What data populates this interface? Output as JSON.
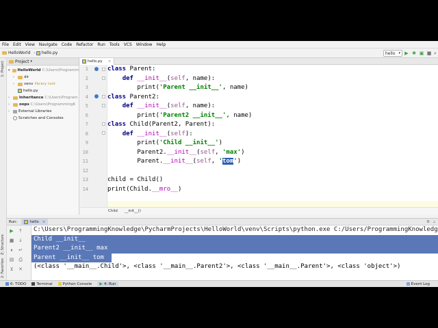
{
  "menu": [
    "File",
    "Edit",
    "View",
    "Navigate",
    "Code",
    "Refactor",
    "Run",
    "Tools",
    "VCS",
    "Window",
    "Help"
  ],
  "nav": {
    "project": "HelloWorld",
    "file": "hello.py"
  },
  "toolbar": {
    "run_config": "hello"
  },
  "left_tabs": {
    "project": "1: Project",
    "structure": "Z: Structure",
    "favorites": "2: Favorites"
  },
  "project_panel": {
    "title": "Project",
    "items": [
      {
        "name": "HelloWorld",
        "detail": "C:\\Users\\Programm"
      },
      {
        "name": "dir",
        "detail": ""
      },
      {
        "name": "venv",
        "detail": "library root"
      },
      {
        "name": "hello.py",
        "detail": ""
      },
      {
        "name": "Inheritance",
        "detail": "C:\\Users\\Program"
      },
      {
        "name": "oops",
        "detail": "C:\\Users\\ProgrammingK"
      },
      {
        "name": "External Libraries",
        "detail": ""
      },
      {
        "name": "Scratches and Consoles",
        "detail": ""
      }
    ]
  },
  "editor": {
    "tab": "hello.py",
    "line_numbers": [
      "1",
      "2",
      "3",
      "4",
      "5",
      "6",
      "7",
      "8",
      "9",
      "10",
      "11",
      "12",
      "13",
      "14"
    ],
    "breadcrumbs": [
      "Child",
      "__init__()"
    ]
  },
  "run_panel": {
    "label": "Run:",
    "tab": "hello",
    "lines": [
      "C:\\Users\\ProgrammingKnowledge\\PycharmProjects\\HelloWorld\\venv\\Scripts\\python.exe C:/Users/ProgrammingKnowledge/PycharmProjects/HelloWorld/hello.py",
      "Child __init__",
      "Parent2 __init__ max",
      "Parent __init__ tom",
      "(<class '__main__.Child'>, <class '__main__.Parent2'>, <class '__main__.Parent'>, <class 'object'>)"
    ]
  },
  "status": {
    "todo": "6: TODO",
    "terminal": "Terminal",
    "console": "Python Console",
    "run": "4: Run",
    "event_log": "Event Log"
  },
  "colors": {
    "keyword": "#000080",
    "string": "#008000",
    "special": "#b200b2",
    "selection": "#2a5db0",
    "console_selection": "#5a78b8"
  }
}
